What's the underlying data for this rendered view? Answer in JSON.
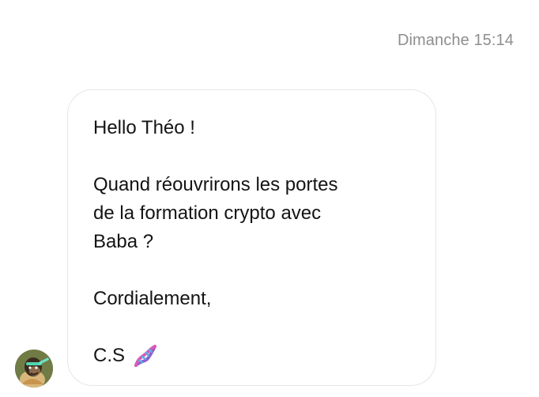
{
  "thread": {
    "timestamp": "Dimanche 15:14"
  },
  "message": {
    "greeting": "Hello Théo !",
    "body_lines": [
      "Quand réouvrirons les portes",
      "de la formation crypto avec",
      "Baba ?"
    ],
    "closing": "Cordialement,",
    "signature": "C.S",
    "signature_icon": "dna-emoji-icon"
  },
  "sender": {
    "avatar_icon": "ape-avatar-icon"
  },
  "colors": {
    "timestamp": "#8e8e8e",
    "bubble_border": "#e6e6e6",
    "text": "#141414",
    "background": "#ffffff"
  }
}
